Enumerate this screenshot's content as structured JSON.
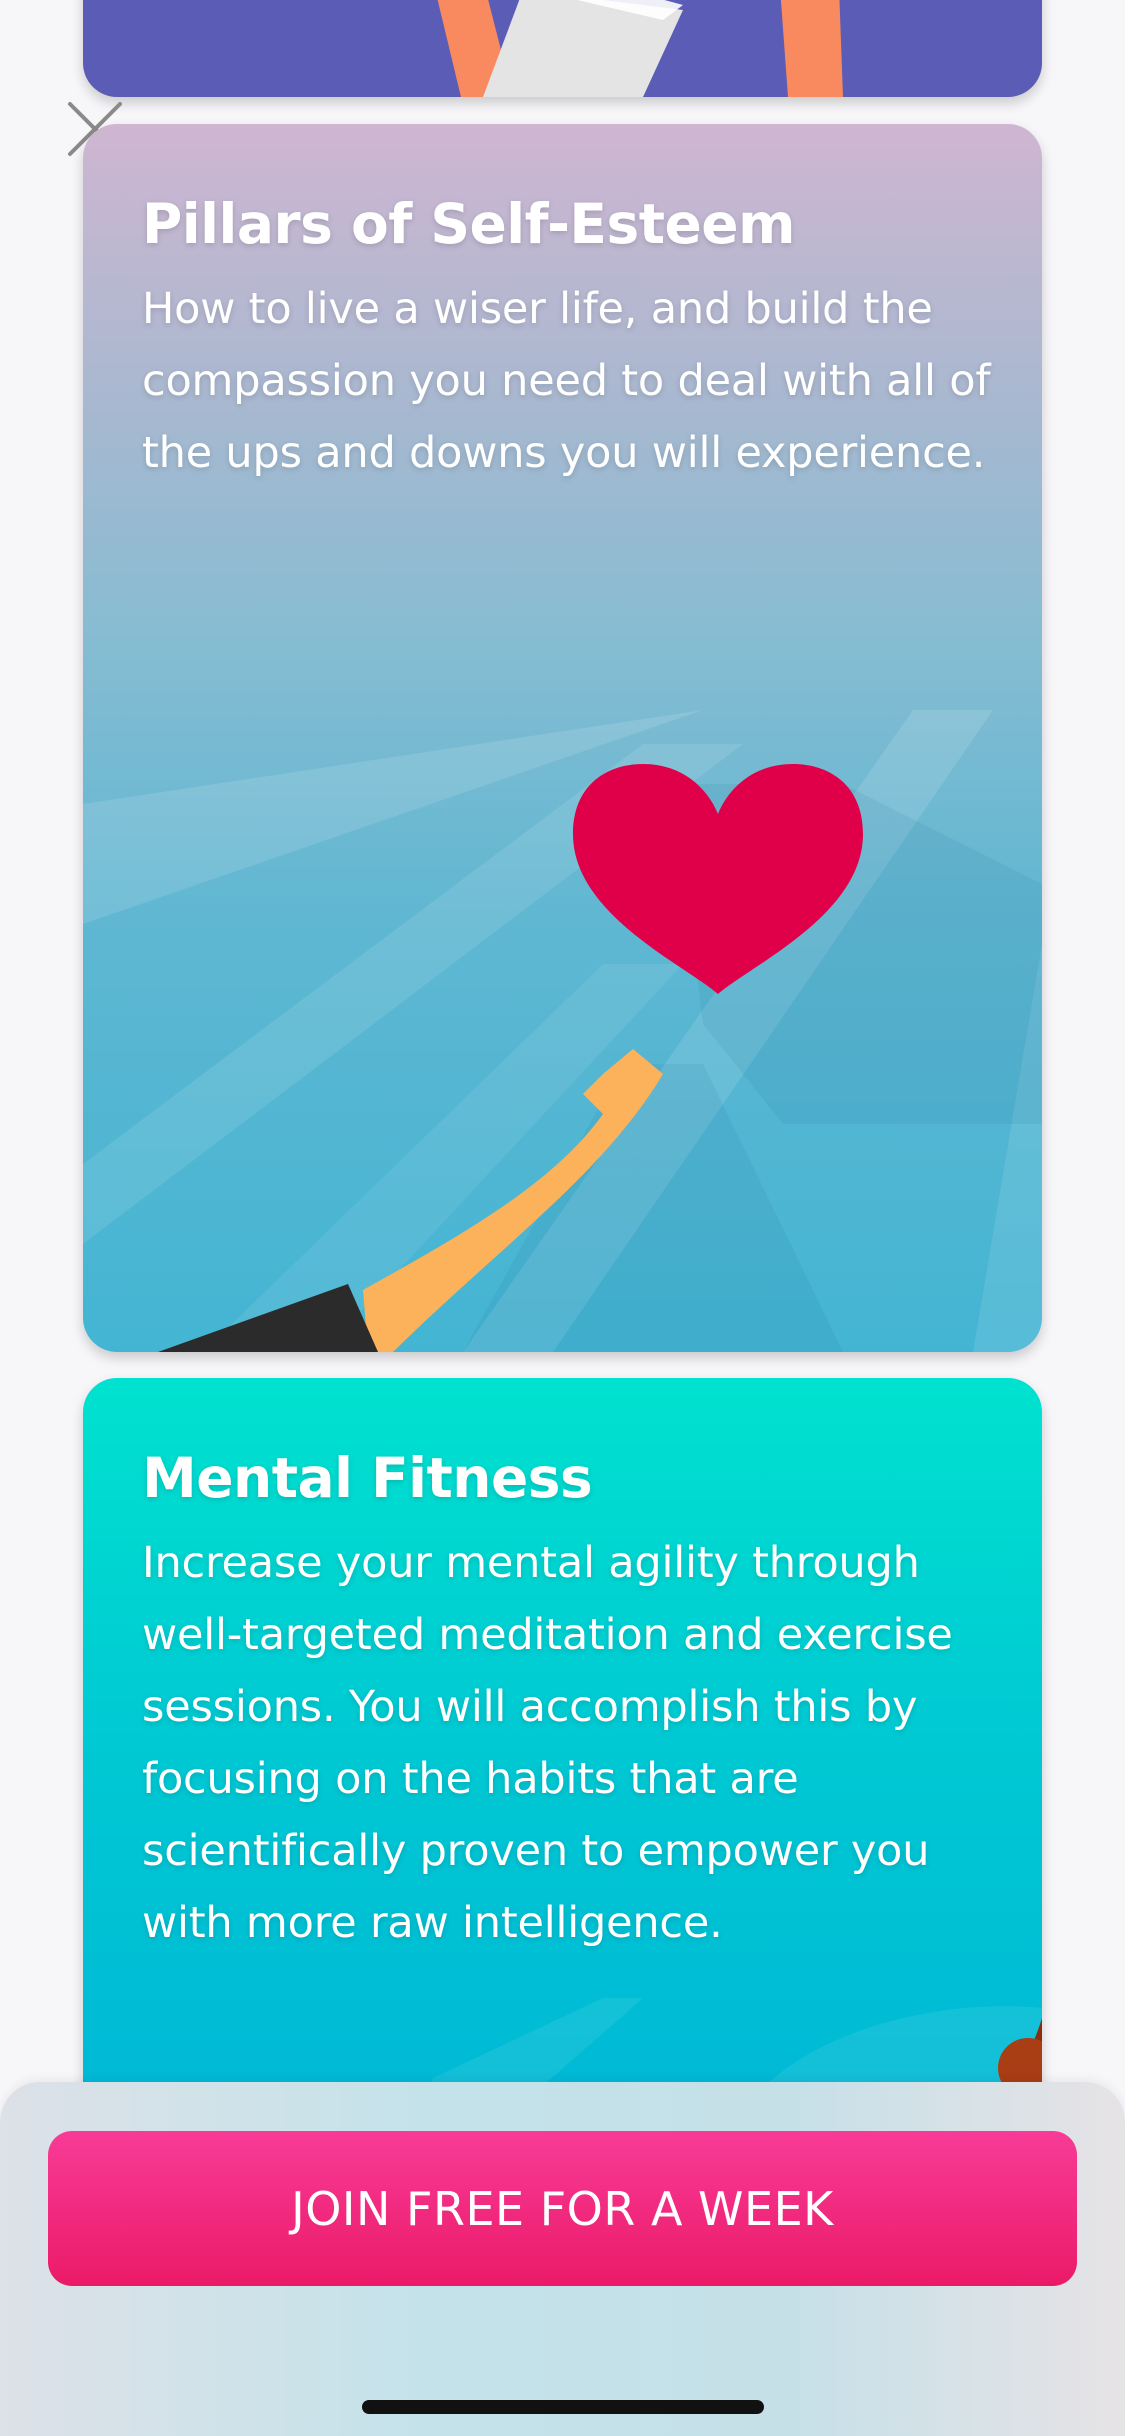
{
  "cards": [
    {
      "title": "Pillars of Self-Esteem",
      "description": "How to live a wiser life, and build the compassion you need to deal with all of the ups and downs you will experience."
    },
    {
      "title": "Mental Fitness",
      "description": "Increase your mental agility through well-targeted meditation and exercise sessions. You will accomplish this by focusing on the habits that are scientifically proven to empower you with more raw intelligence."
    }
  ],
  "cta": {
    "label": "JOIN FREE FOR A WEEK",
    "color": "#ef2477"
  },
  "icons": {
    "close": "close-icon",
    "heart": "heart-illustration"
  },
  "colors": {
    "card_top": "#5b5cb6",
    "card_pillars_top": "#cfb6d1",
    "card_pillars_bottom": "#43b5d3",
    "card_mental_top": "#00e2cf",
    "card_mental_bottom": "#00b7d6",
    "heart": "#e0004a"
  }
}
